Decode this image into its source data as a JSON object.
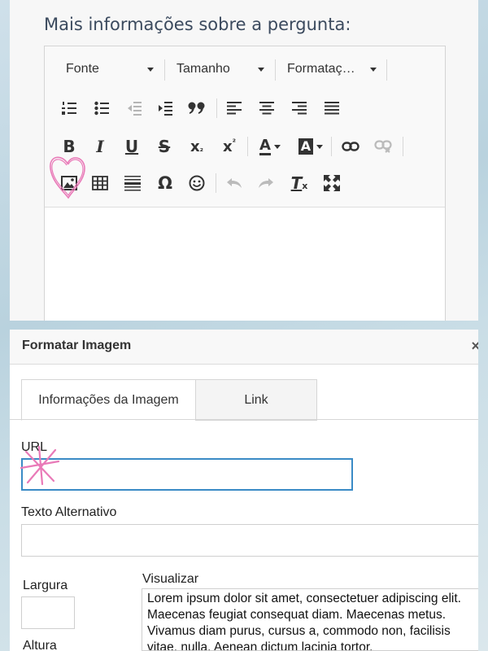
{
  "question_heading": "Mais informações sobre a pergunta:",
  "toolbar": {
    "font_label": "Fonte",
    "size_label": "Tamanho",
    "format_label": "Formataç…",
    "icons": {
      "row1": [
        "numbered-list-icon",
        "bulleted-list-icon",
        "outdent-icon",
        "indent-icon",
        "blockquote-icon",
        "align-left-icon",
        "align-center-icon",
        "align-right-icon",
        "justify-icon"
      ],
      "row2": [
        "bold-icon",
        "italic-icon",
        "underline-icon",
        "strikethrough-icon",
        "subscript-icon",
        "superscript-icon",
        "text-color-icon",
        "background-color-icon",
        "link-icon",
        "unlink-icon"
      ],
      "row3": [
        "image-icon",
        "table-icon",
        "horizontal-line-icon",
        "special-char-icon",
        "emoji-icon",
        "undo-icon",
        "redo-icon",
        "remove-format-icon",
        "maximize-icon"
      ]
    },
    "glyphs": {
      "bold": "B",
      "italic": "I",
      "underline": "U",
      "strike": "S",
      "sub": "x",
      "sub_mark": "₂",
      "sup": "x",
      "sup_mark": "²",
      "text_color": "A",
      "bg_color": "A",
      "omega": "Ω",
      "remove_format": "T",
      "remove_format_mark": "x",
      "quote": "❞"
    }
  },
  "dialog": {
    "title": "Formatar Imagem",
    "close_glyph": "×",
    "tabs": [
      {
        "label": "Informações da Imagem",
        "active": true
      },
      {
        "label": "Link",
        "active": false
      }
    ],
    "url_label": "URL",
    "url_value": "",
    "alt_label": "Texto Alternativo",
    "alt_value": "",
    "width_label": "Largura",
    "width_value": "",
    "height_label": "Altura",
    "preview_label": "Visualizar",
    "preview_text": "Lorem ipsum dolor sit amet, consectetuer adipiscing elit. Maecenas feugiat consequat diam. Maecenas metus. Vivamus diam purus, cursus a, commodo non, facilisis vitae, nulla. Aenean dictum lacinia tortor."
  },
  "colors": {
    "accent_focus": "#3a8bc6",
    "annotation_pink": "#e97ab8",
    "heading": "#3b4a5e"
  }
}
